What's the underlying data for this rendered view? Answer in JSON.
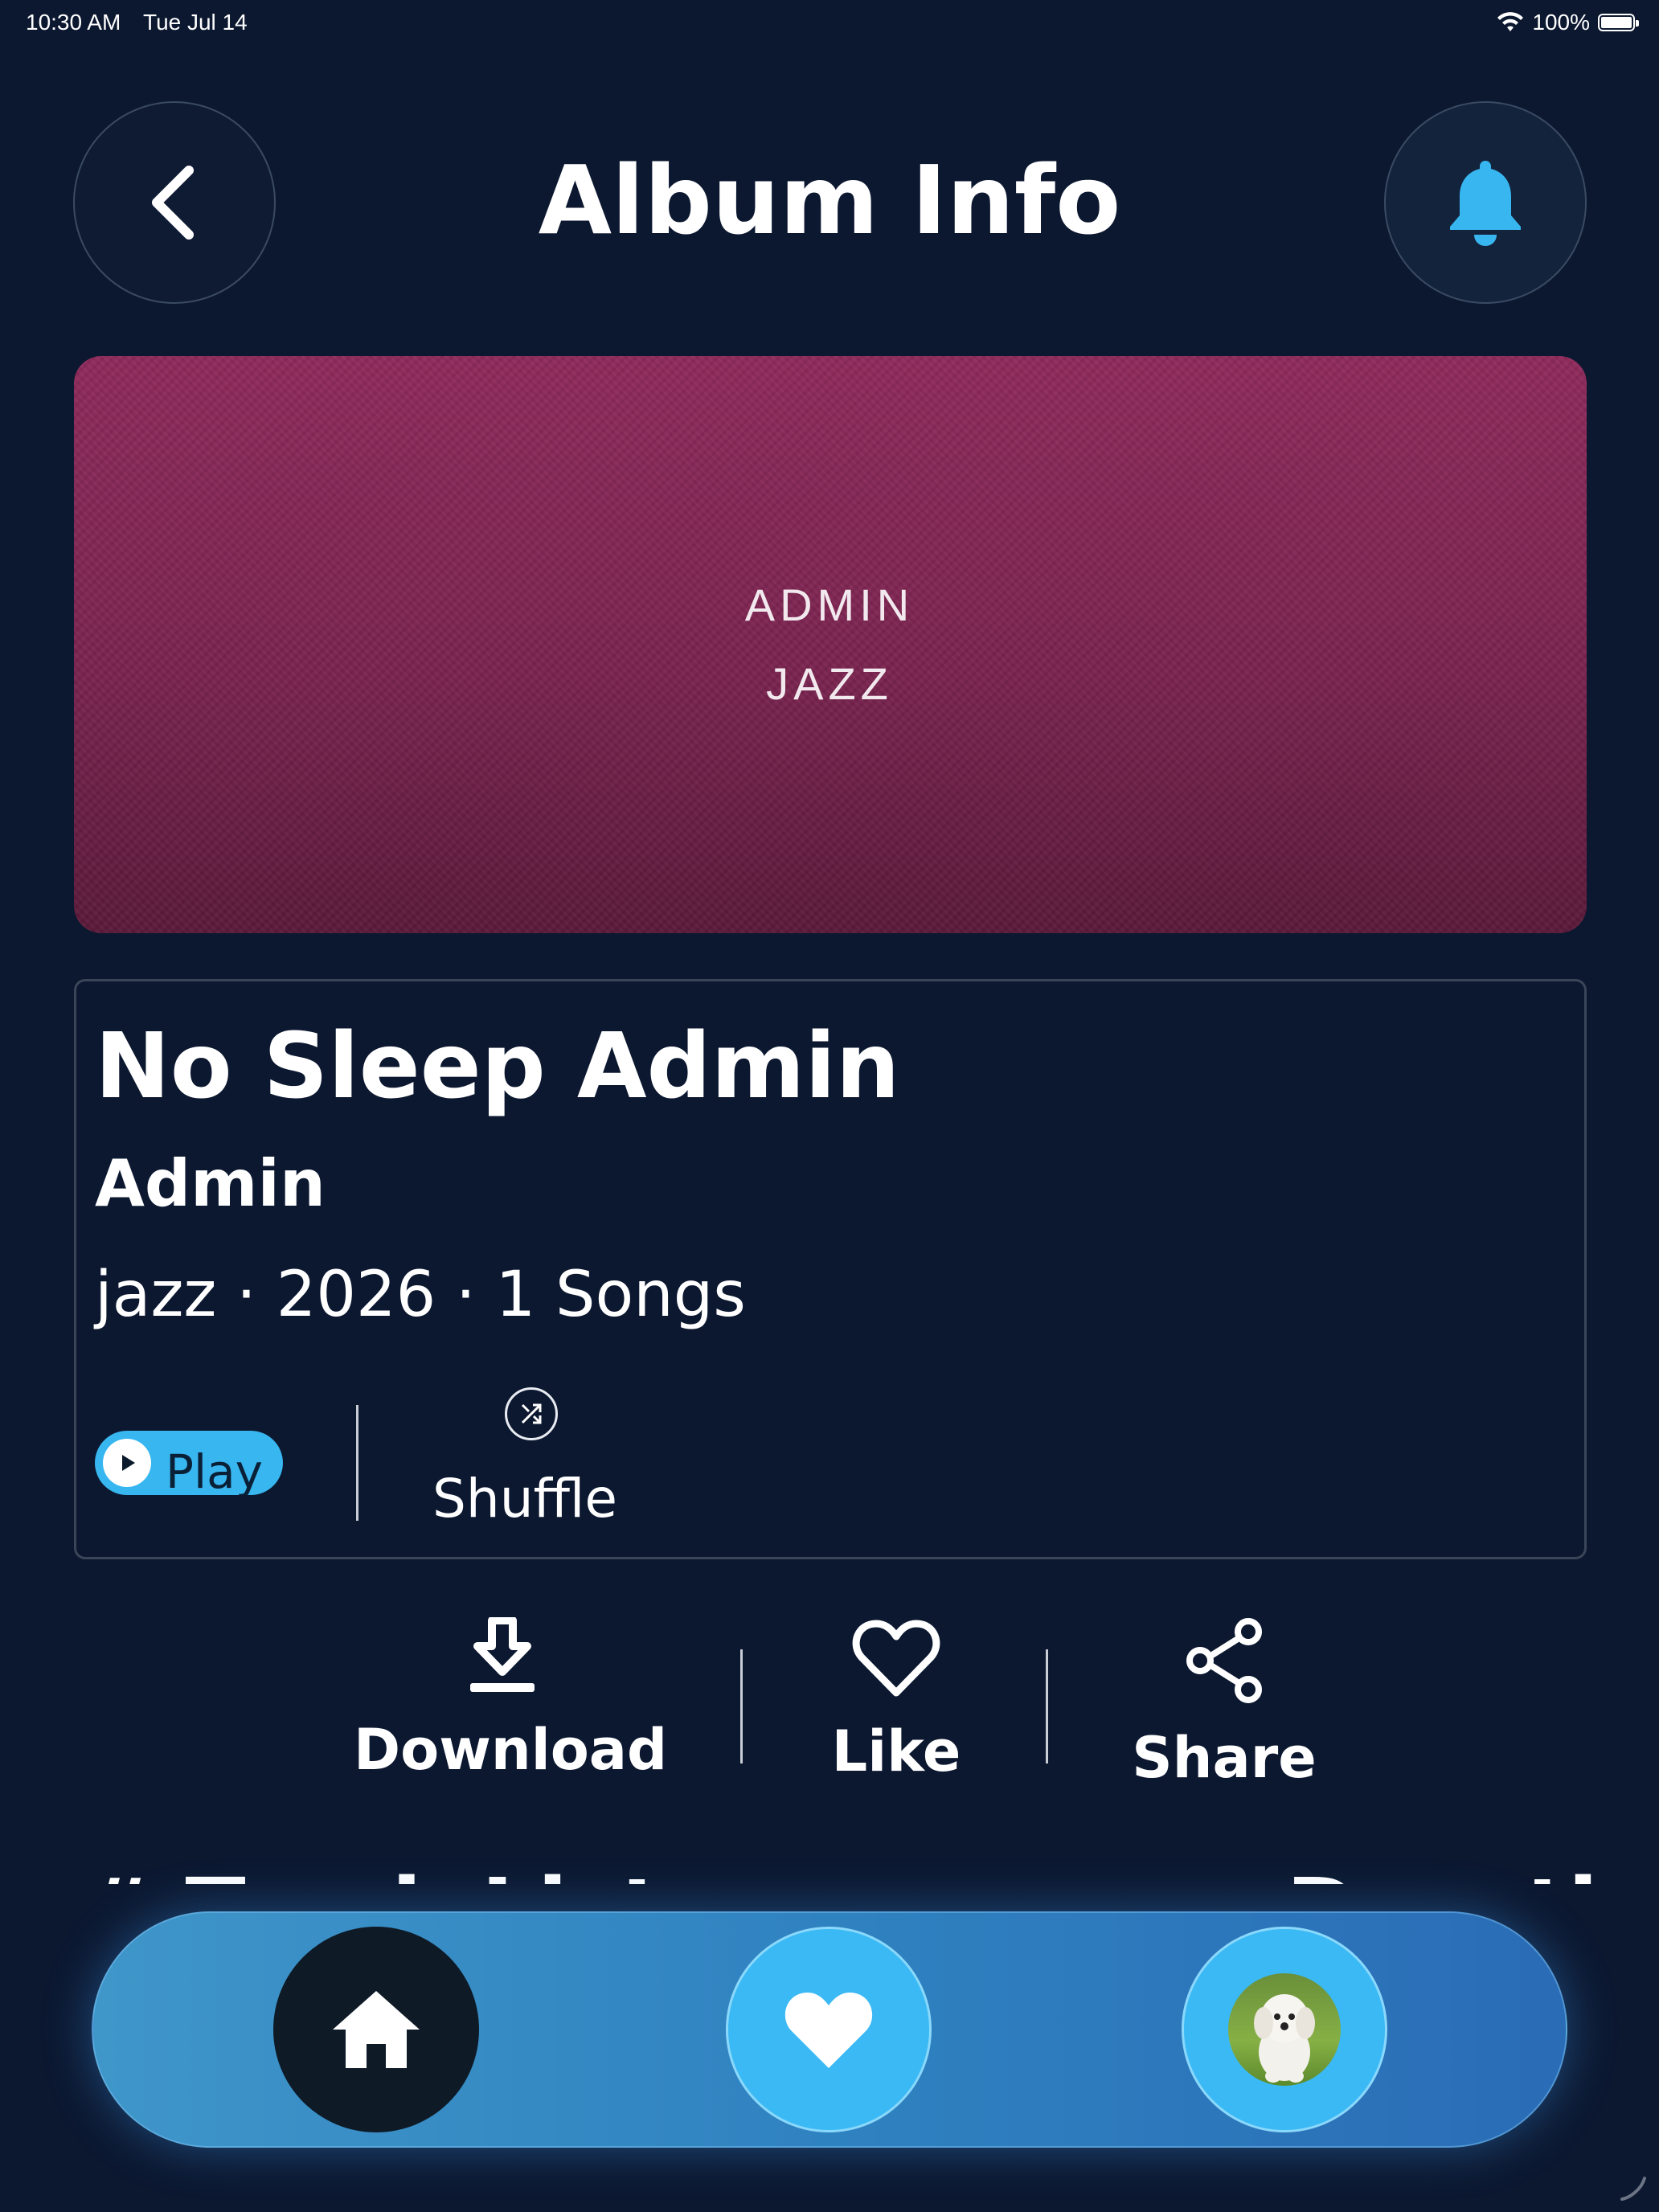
{
  "status_bar": {
    "time": "10:30 AM",
    "date": "Tue Jul 14",
    "battery": "100%"
  },
  "header": {
    "title": "Album Info",
    "back_icon": "chevron-left-icon",
    "notification_icon": "bell-icon"
  },
  "cover": {
    "line1": "ADMIN",
    "line2": "JAZZ",
    "colors": {
      "top": "#8f2a5c",
      "bottom": "#5b1a3a"
    }
  },
  "album": {
    "title": "No Sleep Admin",
    "artist": "Admin",
    "meta": "jazz · 2026 · 1 Songs"
  },
  "controls": {
    "play_label": "Play",
    "shuffle_label": "Shuffle"
  },
  "actions": {
    "download_label": "Download",
    "like_label": "Like",
    "share_label": "Share"
  },
  "tracklist_peek": {
    "left": "# Track List",
    "right": "Duration"
  },
  "tab_bar": {
    "items": [
      {
        "name": "home",
        "icon": "home-icon",
        "active": true
      },
      {
        "name": "favorites",
        "icon": "heart-icon",
        "active": false
      },
      {
        "name": "profile",
        "icon": "avatar",
        "active": false
      }
    ]
  },
  "theme": {
    "background": "#0c1830",
    "accent": "#38b6f0",
    "bell": "#38b6f0"
  }
}
